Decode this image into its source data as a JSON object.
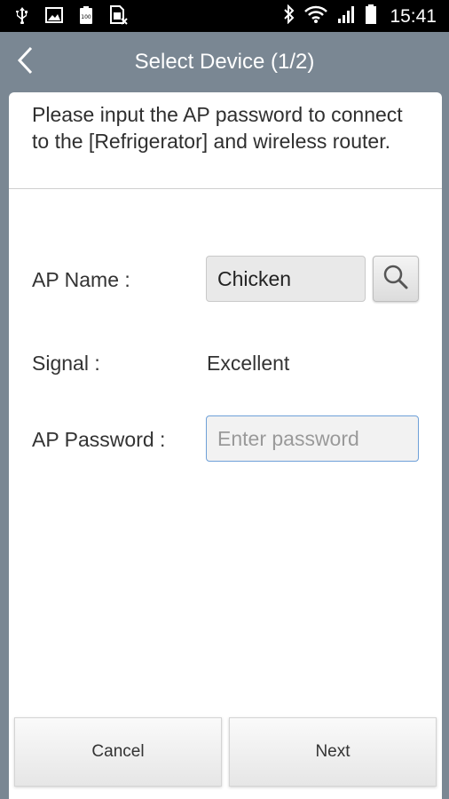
{
  "status_bar": {
    "time": "15:41",
    "left_icons": [
      "usb-icon",
      "image-icon",
      "battery-100-icon",
      "sim-card-icon"
    ],
    "right_icons": [
      "bluetooth-icon",
      "wifi-icon",
      "cell-signal-icon",
      "battery-icon"
    ],
    "battery_badge": "100"
  },
  "header": {
    "title": "Select Device (1/2)",
    "back_icon": "chevron-left-icon"
  },
  "instructions": "Please input the AP password to connect to the [Refrigerator] and wireless router.",
  "form": {
    "ap_name_label": "AP Name :",
    "ap_name_value": "Chicken",
    "search_icon": "search-icon",
    "signal_label": "Signal :",
    "signal_value": "Excellent",
    "password_label": "AP Password :",
    "password_value": "",
    "password_placeholder": "Enter password"
  },
  "buttons": {
    "cancel": "Cancel",
    "next": "Next"
  },
  "colors": {
    "header_bg": "#7a8793",
    "input_focus_border": "#6ea0d8"
  }
}
